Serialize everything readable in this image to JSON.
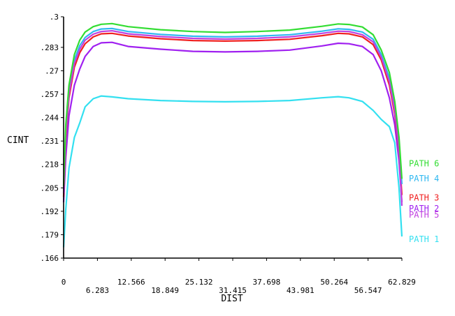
{
  "chart_data": {
    "type": "line",
    "xlabel": "DIST",
    "ylabel": "CINT",
    "xlim": [
      0,
      62.829
    ],
    "ylim": [
      0.166,
      0.3
    ],
    "x_ticks": [
      {
        "label": "0",
        "value": 0,
        "row": 0
      },
      {
        "label": "6.283",
        "value": 6.283,
        "row": 1
      },
      {
        "label": "12.566",
        "value": 12.566,
        "row": 0
      },
      {
        "label": "18.849",
        "value": 18.849,
        "row": 1
      },
      {
        "label": "25.132",
        "value": 25.132,
        "row": 0
      },
      {
        "label": "31.415",
        "value": 31.415,
        "row": 1
      },
      {
        "label": "37.698",
        "value": 37.698,
        "row": 0
      },
      {
        "label": "43.981",
        "value": 43.981,
        "row": 1
      },
      {
        "label": "50.264",
        "value": 50.264,
        "row": 0
      },
      {
        "label": "56.547",
        "value": 56.547,
        "row": 1
      },
      {
        "label": "62.829",
        "value": 62.829,
        "row": 0
      }
    ],
    "y_ticks": [
      {
        "label": ".166",
        "value": 0.166
      },
      {
        "label": ".179",
        "value": 0.179
      },
      {
        "label": ".192",
        "value": 0.192
      },
      {
        "label": ".205",
        "value": 0.205
      },
      {
        "label": ".218",
        "value": 0.218
      },
      {
        "label": ".231",
        "value": 0.231
      },
      {
        "label": ".244",
        "value": 0.244
      },
      {
        "label": ".257",
        "value": 0.257
      },
      {
        "label": ".27",
        "value": 0.27
      },
      {
        "label": ".283",
        "value": 0.283
      },
      {
        "label": ".3",
        "value": 0.3
      }
    ],
    "grid": false,
    "legend_placement": "right",
    "series": [
      {
        "name": "PATH 1",
        "color": "#33e0f0",
        "legend_value": 0.1765,
        "x": [
          0,
          0.4,
          1.0,
          2.0,
          3.0,
          4.0,
          5.5,
          7.0,
          9.0,
          12.0,
          18.0,
          24.0,
          30.0,
          36.0,
          42.0,
          48.0,
          51.0,
          53.0,
          55.5,
          57.5,
          59.0,
          60.5,
          61.5,
          62.3,
          62.829
        ],
        "y": [
          0.172,
          0.193,
          0.216,
          0.233,
          0.241,
          0.25,
          0.2545,
          0.256,
          0.2555,
          0.2545,
          0.2535,
          0.253,
          0.2528,
          0.253,
          0.2535,
          0.255,
          0.2556,
          0.255,
          0.253,
          0.248,
          0.243,
          0.239,
          0.23,
          0.205,
          0.178
        ]
      },
      {
        "name": "PATH 2",
        "color": "#a020f0",
        "legend_value": 0.1935,
        "x": [
          0,
          0.4,
          1.0,
          2.0,
          3.0,
          4.0,
          5.5,
          7.0,
          9.0,
          12.0,
          18.0,
          24.0,
          30.0,
          36.0,
          42.0,
          48.0,
          51.0,
          53.0,
          55.5,
          57.5,
          59.0,
          60.5,
          61.5,
          62.3,
          62.829
        ],
        "y": [
          0.197,
          0.222,
          0.245,
          0.262,
          0.271,
          0.278,
          0.2835,
          0.2855,
          0.2858,
          0.2835,
          0.282,
          0.2808,
          0.2805,
          0.2808,
          0.2815,
          0.2838,
          0.2853,
          0.285,
          0.2835,
          0.279,
          0.27,
          0.255,
          0.24,
          0.22,
          0.197
        ]
      },
      {
        "name": "PATH 3",
        "color": "#f02020",
        "legend_value": 0.1995,
        "x": [
          0,
          0.4,
          1.0,
          2.0,
          3.0,
          4.0,
          5.5,
          7.0,
          9.0,
          12.0,
          18.0,
          24.0,
          30.0,
          36.0,
          42.0,
          48.0,
          51.0,
          53.0,
          55.5,
          57.5,
          59.0,
          60.5,
          61.5,
          62.3,
          62.829
        ],
        "y": [
          0.2,
          0.232,
          0.255,
          0.272,
          0.28,
          0.285,
          0.2888,
          0.2905,
          0.2908,
          0.2893,
          0.2878,
          0.2868,
          0.2865,
          0.2868,
          0.2875,
          0.2895,
          0.2908,
          0.2905,
          0.2888,
          0.2845,
          0.276,
          0.262,
          0.246,
          0.225,
          0.201
        ]
      },
      {
        "name": "PATH 4",
        "color": "#2fb8f0",
        "legend_value": 0.2101,
        "x": [
          0,
          0.4,
          1.0,
          2.0,
          3.0,
          4.0,
          5.5,
          7.0,
          9.0,
          12.0,
          18.0,
          24.0,
          30.0,
          36.0,
          42.0,
          48.0,
          51.0,
          53.0,
          55.5,
          57.5,
          59.0,
          60.5,
          61.5,
          62.3,
          62.829
        ],
        "y": [
          0.204,
          0.237,
          0.259,
          0.276,
          0.284,
          0.2885,
          0.2918,
          0.2932,
          0.2935,
          0.2918,
          0.2902,
          0.2892,
          0.2888,
          0.2892,
          0.29,
          0.292,
          0.2933,
          0.293,
          0.2915,
          0.2875,
          0.279,
          0.266,
          0.25,
          0.23,
          0.207
        ]
      },
      {
        "name": "PATH 5",
        "color": "#c040e0",
        "legend_value": 0.19,
        "x": [
          0,
          0.4,
          1.0,
          2.0,
          3.0,
          4.0,
          5.5,
          7.0,
          9.0,
          12.0,
          18.0,
          24.0,
          30.0,
          36.0,
          42.0,
          48.0,
          51.0,
          53.0,
          55.5,
          57.5,
          59.0,
          60.5,
          61.5,
          62.3,
          62.829
        ],
        "y": [
          0.202,
          0.234,
          0.257,
          0.274,
          0.282,
          0.287,
          0.2903,
          0.2918,
          0.2922,
          0.2905,
          0.289,
          0.288,
          0.2876,
          0.288,
          0.2888,
          0.2908,
          0.292,
          0.2918,
          0.29,
          0.286,
          0.2775,
          0.264,
          0.248,
          0.226,
          0.195
        ]
      },
      {
        "name": "PATH 6",
        "color": "#33dd33",
        "legend_value": 0.2185,
        "x": [
          0,
          0.4,
          1.0,
          2.0,
          3.0,
          4.0,
          5.5,
          7.0,
          9.0,
          12.0,
          18.0,
          24.0,
          30.0,
          36.0,
          42.0,
          48.0,
          51.0,
          53.0,
          55.5,
          57.5,
          59.0,
          60.5,
          61.5,
          62.3,
          62.829
        ],
        "y": [
          0.206,
          0.24,
          0.262,
          0.279,
          0.287,
          0.2915,
          0.2945,
          0.2958,
          0.2962,
          0.2945,
          0.2928,
          0.2918,
          0.2913,
          0.2918,
          0.2926,
          0.2947,
          0.296,
          0.2957,
          0.2943,
          0.29,
          0.2815,
          0.269,
          0.253,
          0.233,
          0.21
        ]
      }
    ]
  }
}
